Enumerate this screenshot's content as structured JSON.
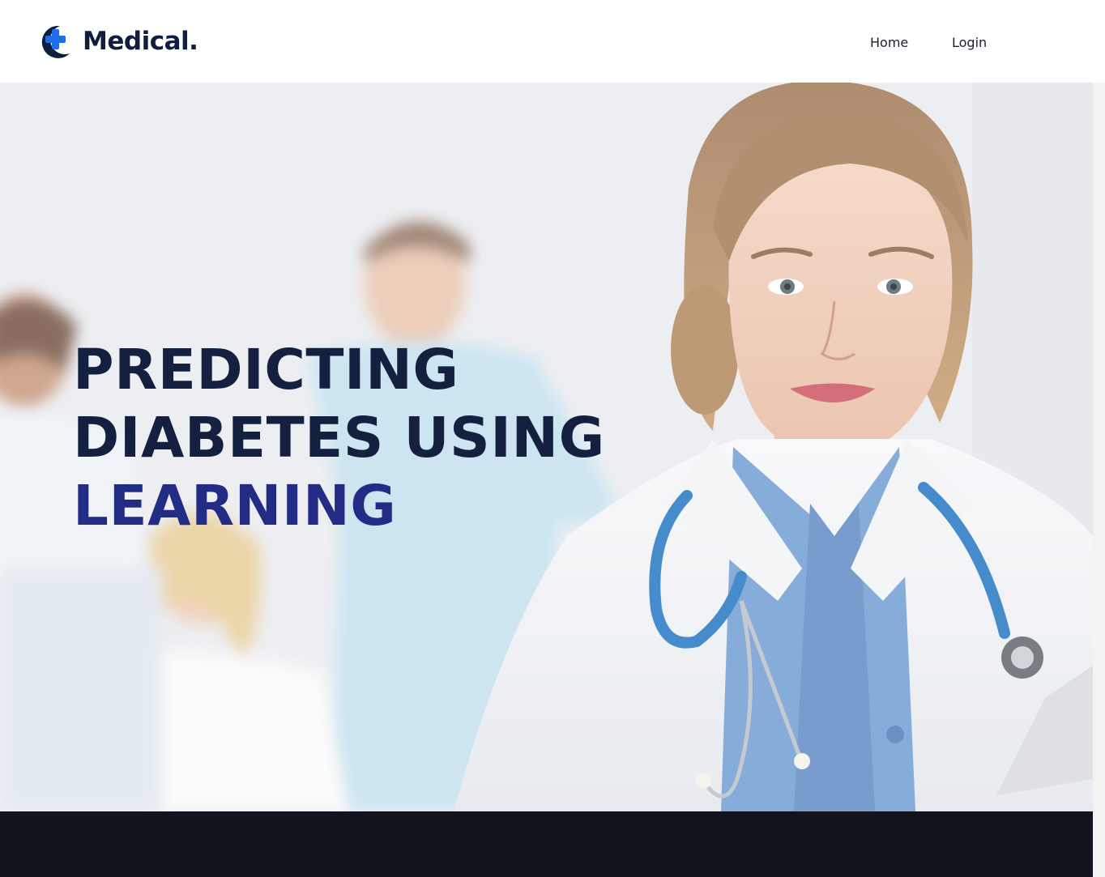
{
  "header": {
    "logo_text": "Medical.",
    "logo_icon": "medical-cross-icon",
    "nav": [
      {
        "label": "Home"
      },
      {
        "label": "Login"
      }
    ]
  },
  "hero": {
    "title_line_1": "PREDICTING",
    "title_line_2": "DIABETES USING",
    "title_line_3": "LEARNING",
    "image_alt": "doctor with stethoscope and patients in background"
  },
  "colors": {
    "brand_dark": "#0f1e3d",
    "brand_accent": "#1f6ee8",
    "title_accent": "#232c85",
    "footer_bg": "#11141c"
  }
}
